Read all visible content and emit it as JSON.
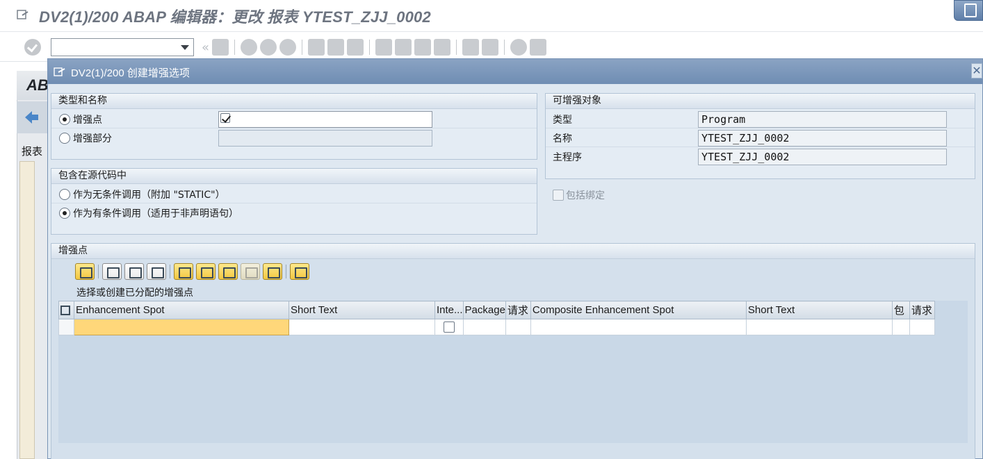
{
  "window": {
    "title": "DV2(1)/200 ABAP 编辑器：更改 报表 YTEST_ZJJ_0002",
    "bg_tab_label": "AB",
    "bg_report_label": "报表"
  },
  "dialog": {
    "title": "DV2(1)/200 创建增强选项",
    "close_glyph": "✕",
    "type_name": {
      "header": "类型和名称",
      "opt_spot": "增强点",
      "opt_section": "增强部分",
      "spot_value": ""
    },
    "source": {
      "header": "包含在源代码中",
      "opt_static": "作为无条件调用（附加 \"STATIC\"）",
      "opt_conditional": "作为有条件调用（适用于非声明语句）"
    },
    "object": {
      "header": "可增强对象",
      "type_label": "类型",
      "type_value": "Program",
      "name_label": "名称",
      "name_value": "YTEST_ZJJ_0002",
      "main_label": "主程序",
      "main_value": "YTEST_ZJJ_0002",
      "include_binding": "包括绑定"
    },
    "spots": {
      "header": "增强点",
      "caption": "选择或创建已分配的增强点",
      "columns": [
        "Enhancement Spot",
        "Short Text",
        "Inte...",
        "Package",
        "请求",
        "Composite Enhancement Spot",
        "Short Text",
        "包",
        "请求"
      ]
    }
  },
  "colors": {
    "dialog_title_bar": "#7a96ba",
    "dialog_bg": "#dfe8f1",
    "highlight_cell": "#ffd77a"
  }
}
